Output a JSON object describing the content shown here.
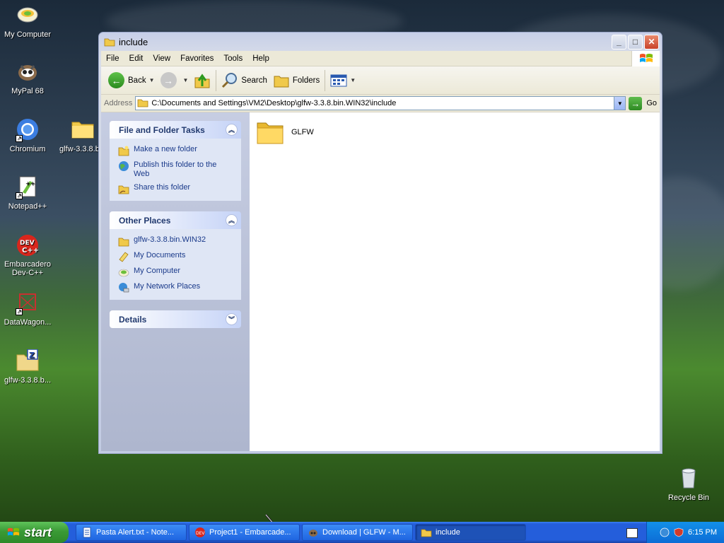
{
  "desktop": {
    "icons": [
      {
        "label": "My Computer",
        "icon": "my-computer-icon"
      },
      {
        "label": "MyPal 68",
        "icon": "mypal-icon"
      },
      {
        "label": "Chromium",
        "icon": "chromium-icon"
      },
      {
        "label": "glfw-3.3.8.b...",
        "icon": "folder-icon"
      },
      {
        "label": "Notepad++",
        "icon": "notepadpp-icon"
      },
      {
        "label": "Embarcadero Dev-C++",
        "icon": "devcpp-icon"
      },
      {
        "label": "DataWagon...",
        "icon": "datawagon-icon"
      },
      {
        "label": "glfw-3.3.8.b...",
        "icon": "zip-folder-icon"
      },
      {
        "label": "Recycle Bin",
        "icon": "recycle-bin-icon"
      }
    ]
  },
  "window": {
    "title": "include",
    "menu": [
      "File",
      "Edit",
      "View",
      "Favorites",
      "Tools",
      "Help"
    ],
    "toolbar": {
      "back": "Back",
      "search": "Search",
      "folders": "Folders"
    },
    "address": {
      "label": "Address",
      "value": "C:\\Documents and Settings\\VM2\\Desktop\\glfw-3.3.8.bin.WIN32\\include",
      "go": "Go"
    },
    "tasks_panel": {
      "title": "File and Folder Tasks",
      "items": [
        "Make a new folder",
        "Publish this folder to the Web",
        "Share this folder"
      ]
    },
    "places_panel": {
      "title": "Other Places",
      "items": [
        "glfw-3.3.8.bin.WIN32",
        "My Documents",
        "My Computer",
        "My Network Places"
      ]
    },
    "details_panel": {
      "title": "Details"
    },
    "files": [
      {
        "name": "GLFW",
        "type": "folder"
      }
    ]
  },
  "taskbar": {
    "start": "start",
    "buttons": [
      {
        "label": "Pasta Alert.txt - Note...",
        "icon": "notepad-icon"
      },
      {
        "label": "Project1 - Embarcade...",
        "icon": "devcpp-icon"
      },
      {
        "label": "Download | GLFW - M...",
        "icon": "mypal-icon"
      },
      {
        "label": "include",
        "icon": "folder-icon",
        "active": true
      }
    ],
    "clock": "6:15 PM"
  }
}
